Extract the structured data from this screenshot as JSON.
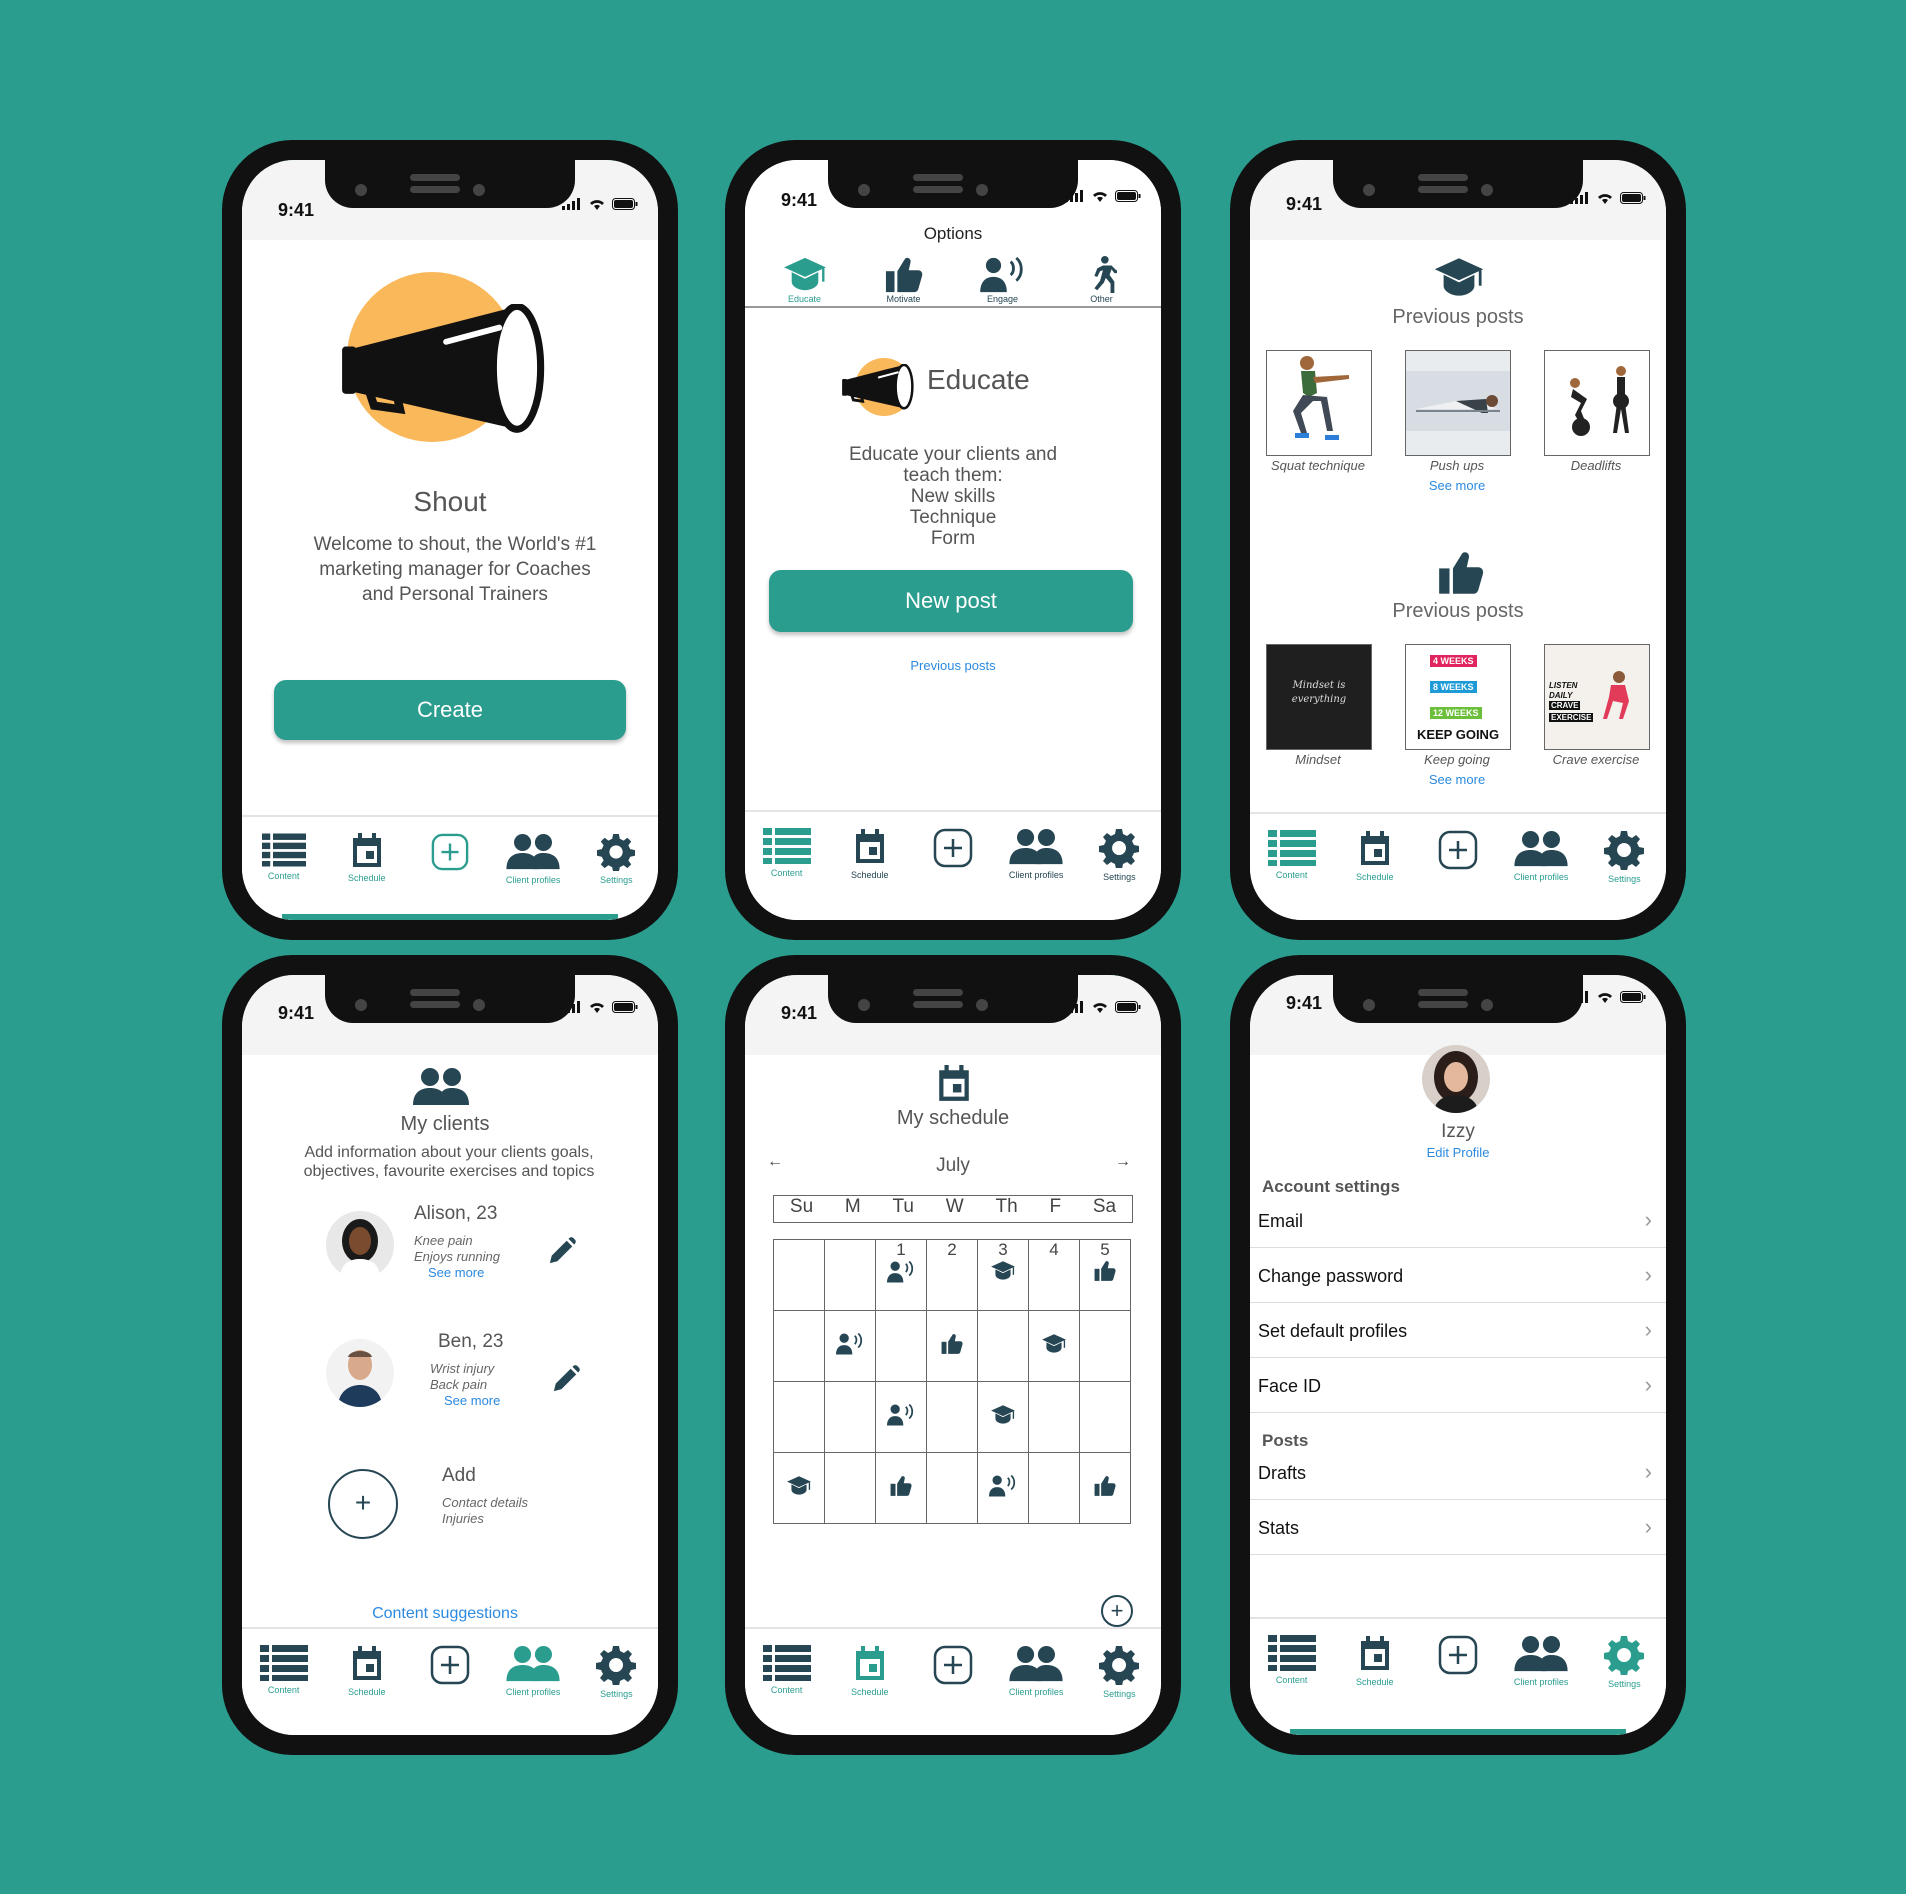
{
  "status_time": "9:41",
  "nav": {
    "content": "Content",
    "schedule": "Schedule",
    "clients": "Client profiles",
    "settings": "Settings"
  },
  "screen1": {
    "title": "Shout",
    "welcome": "Welcome to shout, the World's #1 marketing manager for Coaches and Personal Trainers",
    "create_button": "Create"
  },
  "screen2": {
    "options_title": "Options",
    "tabs": [
      {
        "label": "Educate"
      },
      {
        "label": "Motivate"
      },
      {
        "label": "Engage"
      },
      {
        "label": "Other"
      }
    ],
    "heading": "Educate",
    "description_lines": [
      "Educate your clients and",
      "teach them:",
      "New skills",
      "Technique",
      "Form"
    ],
    "new_post_button": "New post",
    "previous_posts_link": "Previous posts"
  },
  "screen3": {
    "section1_title": "Previous posts",
    "section1_items": [
      {
        "caption": "Squat technique"
      },
      {
        "caption": "Push ups"
      },
      {
        "caption": "Deadlifts"
      }
    ],
    "section2_title": "Previous posts",
    "section2_items": [
      {
        "caption": "Mindset"
      },
      {
        "caption": "Keep going"
      },
      {
        "caption": "Crave exercise"
      }
    ],
    "see_more": "See more",
    "thumb_texts": {
      "mindset": "Mindset is everything",
      "keep_going": "KEEP GOING",
      "weeks": [
        "4 WEEKS",
        "8 WEEKS",
        "12 WEEKS"
      ],
      "crave": [
        "LISTEN",
        "DAILY",
        "CRAVE",
        "EXERCISE"
      ]
    }
  },
  "screen4": {
    "title": "My clients",
    "description": "Add information about your clients goals, objectives, favourite exercises and topics",
    "clients": [
      {
        "name": "Alison, 23",
        "notes": [
          "Knee pain",
          "Enjoys running"
        ]
      },
      {
        "name": "Ben, 23",
        "notes": [
          "Wrist injury",
          "Back pain"
        ]
      }
    ],
    "add_title": "Add",
    "add_notes": [
      "Contact details",
      "Injuries"
    ],
    "see_more": "See more",
    "content_suggestions": "Content suggestions"
  },
  "screen5": {
    "title": "My schedule",
    "month": "July",
    "prev_arrow": "←",
    "next_arrow": "→",
    "weekdays": [
      "Su",
      "M",
      "Tu",
      "W",
      "Th",
      "F",
      "Sa"
    ],
    "dates": [
      "1",
      "2",
      "3",
      "4",
      "5"
    ]
  },
  "screen6": {
    "name": "Izzy",
    "edit_profile": "Edit Profile",
    "account_section": "Account settings",
    "account_rows": [
      "Email",
      "Change password",
      "Set default profiles",
      "Face ID"
    ],
    "posts_section": "Posts",
    "posts_rows": [
      "Drafts",
      "Stats"
    ],
    "chevron": "›"
  },
  "colors": {
    "background": "#2a9d8f",
    "accent": "#2a9d8f",
    "dark_icon": "#264653",
    "sun": "#f9b95b",
    "link": "#2b8ae0"
  }
}
